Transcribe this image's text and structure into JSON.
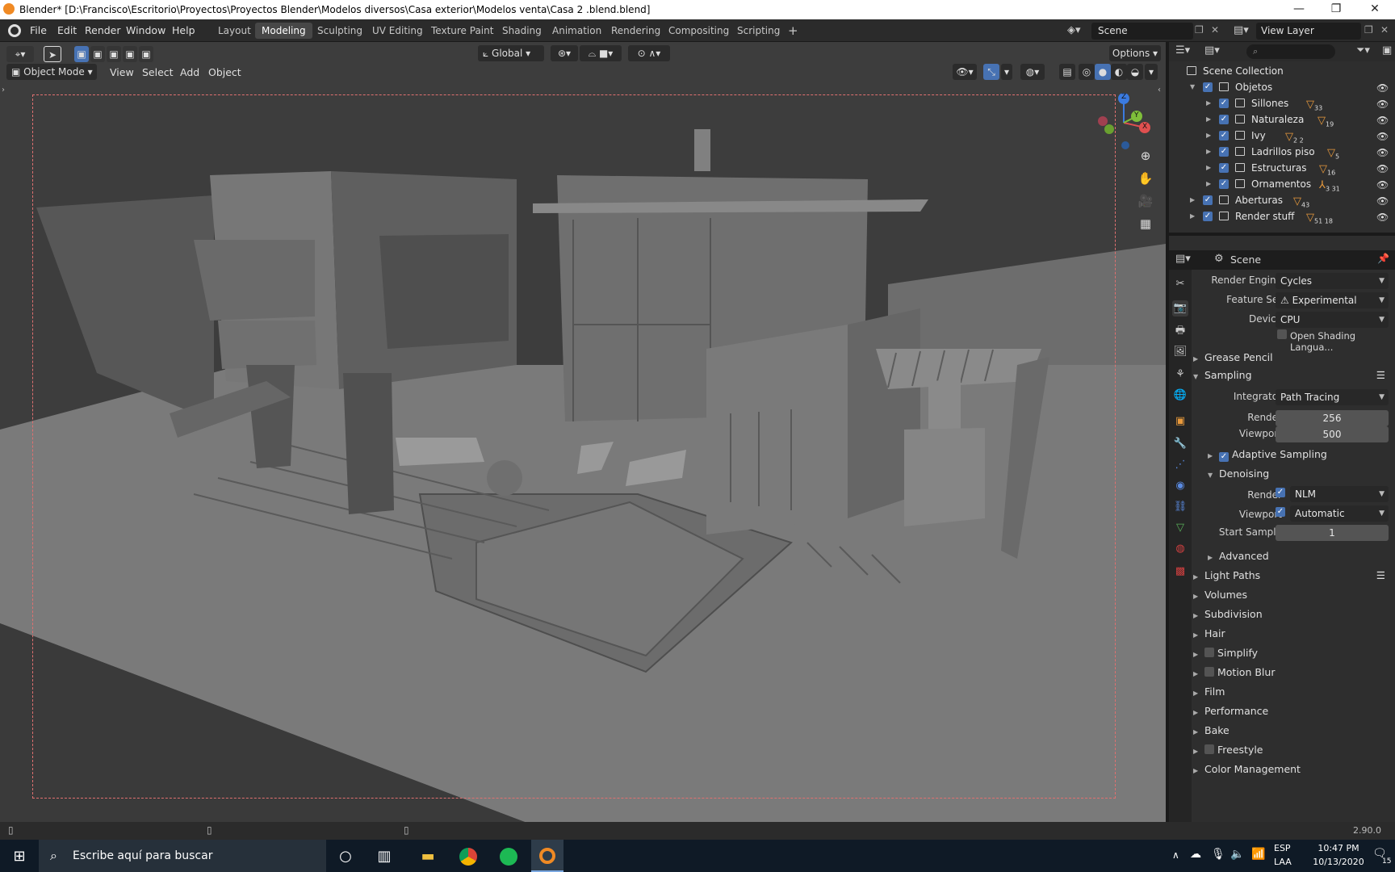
{
  "titlebar": {
    "title": "Blender* [D:\\Francisco\\Escritorio\\Proyectos\\Proyectos Blender\\Modelos diversos\\Casa exterior\\Modelos venta\\Casa 2 .blend.blend]",
    "minimize": "—",
    "maximize": "❐",
    "close": "✕"
  },
  "menu": {
    "items": [
      "File",
      "Edit",
      "Render",
      "Window",
      "Help"
    ]
  },
  "workspaces": {
    "tabs": [
      "Layout",
      "Modeling",
      "Sculpting",
      "UV Editing",
      "Texture Paint",
      "Shading",
      "Animation",
      "Rendering",
      "Compositing",
      "Scripting"
    ],
    "active": "Modeling",
    "add": "+"
  },
  "scene_selector": {
    "value": "Scene"
  },
  "view_layer_selector": {
    "value": "View Layer"
  },
  "viewport": {
    "transform_orientation": "Global",
    "options_label": "Options",
    "mode": "Object Mode",
    "header_menus": [
      "View",
      "Select",
      "Add",
      "Object"
    ],
    "gizmo": {
      "x": "X",
      "y": "Y",
      "z": "Z"
    }
  },
  "outliner": {
    "root": "Scene Collection",
    "rows": [
      {
        "name": "Objetos",
        "level": 1,
        "badge": ""
      },
      {
        "name": "Sillones",
        "level": 2,
        "badge": "33"
      },
      {
        "name": "Naturaleza",
        "level": 2,
        "badge": "19"
      },
      {
        "name": "Ivy",
        "level": 2,
        "badge": "2  2"
      },
      {
        "name": "Ladrillos piso",
        "level": 2,
        "badge": "5"
      },
      {
        "name": "Estructuras",
        "level": 2,
        "badge": "16"
      },
      {
        "name": "Ornamentos",
        "level": 2,
        "badge": "3  31"
      },
      {
        "name": "Aberturas",
        "level": 1,
        "badge": "43"
      },
      {
        "name": "Render stuff",
        "level": 1,
        "badge": "51  18"
      }
    ]
  },
  "properties": {
    "context": "Scene",
    "render_engine": {
      "label": "Render Engine",
      "value": "Cycles"
    },
    "feature_set": {
      "label": "Feature Set",
      "value": "Experimental"
    },
    "device": {
      "label": "Device",
      "value": "CPU"
    },
    "osl": {
      "label": "Open Shading Langua...",
      "checked": false
    },
    "panels": {
      "grease_pencil": "Grease Pencil",
      "sampling": "Sampling",
      "integrator": {
        "label": "Integrator",
        "value": "Path Tracing"
      },
      "render_samples": {
        "label": "Render",
        "value": "256"
      },
      "viewport_samples": {
        "label": "Viewport",
        "value": "500"
      },
      "adaptive_sampling": "Adaptive Sampling",
      "denoising": "Denoising",
      "denoise_render": {
        "label": "Render",
        "value": "NLM"
      },
      "denoise_viewport": {
        "label": "Viewport",
        "value": "Automatic"
      },
      "start_sample": {
        "label": "Start Sample",
        "value": "1"
      },
      "advanced": "Advanced",
      "light_paths": "Light Paths",
      "volumes": "Volumes",
      "subdivision": "Subdivision",
      "hair": "Hair",
      "simplify": "Simplify",
      "motion_blur": "Motion Blur",
      "film": "Film",
      "performance": "Performance",
      "bake": "Bake",
      "freestyle": "Freestyle",
      "color_management": "Color Management"
    }
  },
  "statusbar": {
    "version": "2.90.0"
  },
  "taskbar": {
    "search_placeholder": "Escribe aquí para buscar",
    "lang": "ESP",
    "lang_sub": "LAA",
    "time": "10:47 PM",
    "date": "10/13/2020",
    "notifications": "15"
  },
  "colors": {
    "accent": "#4772b3",
    "active_tab": "#474747",
    "orange": "#e89a3c"
  }
}
